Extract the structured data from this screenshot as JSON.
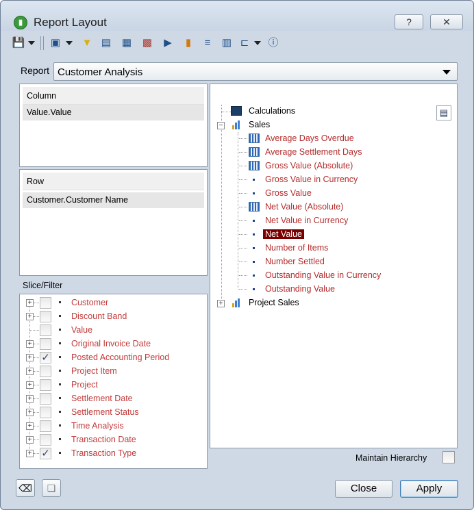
{
  "window": {
    "title": "Report Layout",
    "help_glyph": "?",
    "close_glyph": "✕"
  },
  "report": {
    "label": "Report",
    "selected": "Customer Analysis"
  },
  "column_panel": {
    "header": "Column",
    "items": [
      "Value.Value"
    ]
  },
  "row_panel": {
    "header": "Row",
    "items": [
      "Customer.Customer Name"
    ]
  },
  "slice_filter": {
    "label": "Slice/Filter",
    "items": [
      {
        "label": "Customer",
        "checked": false,
        "expandable": true
      },
      {
        "label": "Discount Band",
        "checked": false,
        "expandable": true
      },
      {
        "label": "Value",
        "checked": false,
        "expandable": false
      },
      {
        "label": "Original Invoice Date",
        "checked": false,
        "expandable": true
      },
      {
        "label": "Posted Accounting Period",
        "checked": true,
        "expandable": true
      },
      {
        "label": "Project Item",
        "checked": false,
        "expandable": true
      },
      {
        "label": "Project",
        "checked": false,
        "expandable": true
      },
      {
        "label": "Settlement Date",
        "checked": false,
        "expandable": true
      },
      {
        "label": "Settlement Status",
        "checked": false,
        "expandable": true
      },
      {
        "label": "Time Analysis",
        "checked": false,
        "expandable": true
      },
      {
        "label": "Transaction Date",
        "checked": false,
        "expandable": true
      },
      {
        "label": "Transaction Type",
        "checked": true,
        "expandable": true
      }
    ]
  },
  "tree": {
    "calculations": "Calculations",
    "sales": {
      "label": "Sales",
      "children": [
        {
          "label": "Average Days Overdue",
          "icon": "measure-icon"
        },
        {
          "label": "Average Settlement Days",
          "icon": "measure-icon"
        },
        {
          "label": "Gross Value (Absolute)",
          "icon": "measure-icon"
        },
        {
          "label": "Gross Value in Currency",
          "icon": "dot"
        },
        {
          "label": "Gross Value",
          "icon": "dot"
        },
        {
          "label": "Net Value (Absolute)",
          "icon": "measure-icon"
        },
        {
          "label": "Net Value in Currency",
          "icon": "dot"
        },
        {
          "label": "Net Value",
          "icon": "dot",
          "selected": true
        },
        {
          "label": "Number of Items",
          "icon": "dot"
        },
        {
          "label": "Number Settled",
          "icon": "dot"
        },
        {
          "label": "Outstanding Value in Currency",
          "icon": "dot"
        },
        {
          "label": "Outstanding Value",
          "icon": "dot"
        }
      ]
    },
    "project_sales": "Project Sales"
  },
  "maintain_hierarchy": {
    "label": "Maintain Hierarchy",
    "checked": false
  },
  "buttons": {
    "close": "Close",
    "apply": "Apply"
  },
  "toolbar_icons": [
    "save-icon",
    "help-list-icon",
    "filter-funnel-icon",
    "layout-icon",
    "table-icon",
    "grid-color-icon",
    "play-table-icon",
    "bar-chart-icon",
    "sort-list-icon",
    "columns-icon",
    "hierarchy-icon",
    "info-icon"
  ],
  "colors": {
    "accent_red": "#b52b2b",
    "selection": "#7a0000",
    "window_bg": "#cfd9e6"
  }
}
